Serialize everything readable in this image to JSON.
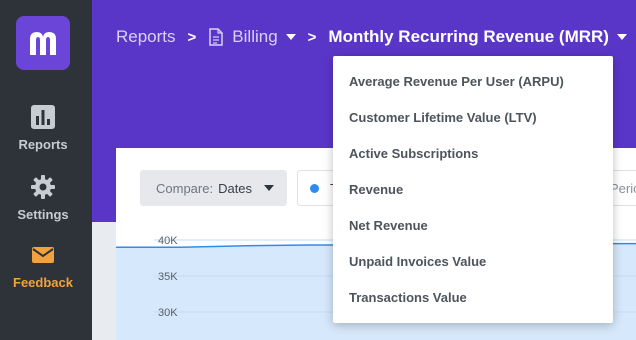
{
  "sidebar": {
    "items": [
      {
        "label": "Reports",
        "icon": "bar-chart-icon"
      },
      {
        "label": "Settings",
        "icon": "gear-icon"
      },
      {
        "label": "Feedback",
        "icon": "envelope-icon"
      }
    ]
  },
  "breadcrumb": {
    "root": "Reports",
    "section": "Billing",
    "current": "Monthly Recurring Revenue (MRR)"
  },
  "toolbar": {
    "compare_key": "Compare:",
    "compare_value": "Dates",
    "legend_text": "T",
    "period_text": "Perio"
  },
  "chart_data": {
    "type": "area",
    "y_ticks": [
      "40K",
      "35K",
      "30K"
    ],
    "series": [
      {
        "values": [
          39000,
          39000,
          39200,
          39300,
          39300,
          39400,
          39400,
          39500,
          39500
        ]
      }
    ],
    "ylim": [
      30000,
      40000
    ],
    "colors": {
      "line": "#2e8cf0",
      "fill": "#d6e8fb"
    }
  },
  "dropdown": {
    "items": [
      "Average Revenue Per User (ARPU)",
      "Customer Lifetime Value (LTV)",
      "Active Subscriptions",
      "Revenue",
      "Net Revenue",
      "Unpaid Invoices Value",
      "Transactions Value"
    ]
  },
  "colors": {
    "sidebar": "#2d3339",
    "header": "#5a36c8",
    "accent": "#6a45d8",
    "feedback": "#f3a23b"
  }
}
